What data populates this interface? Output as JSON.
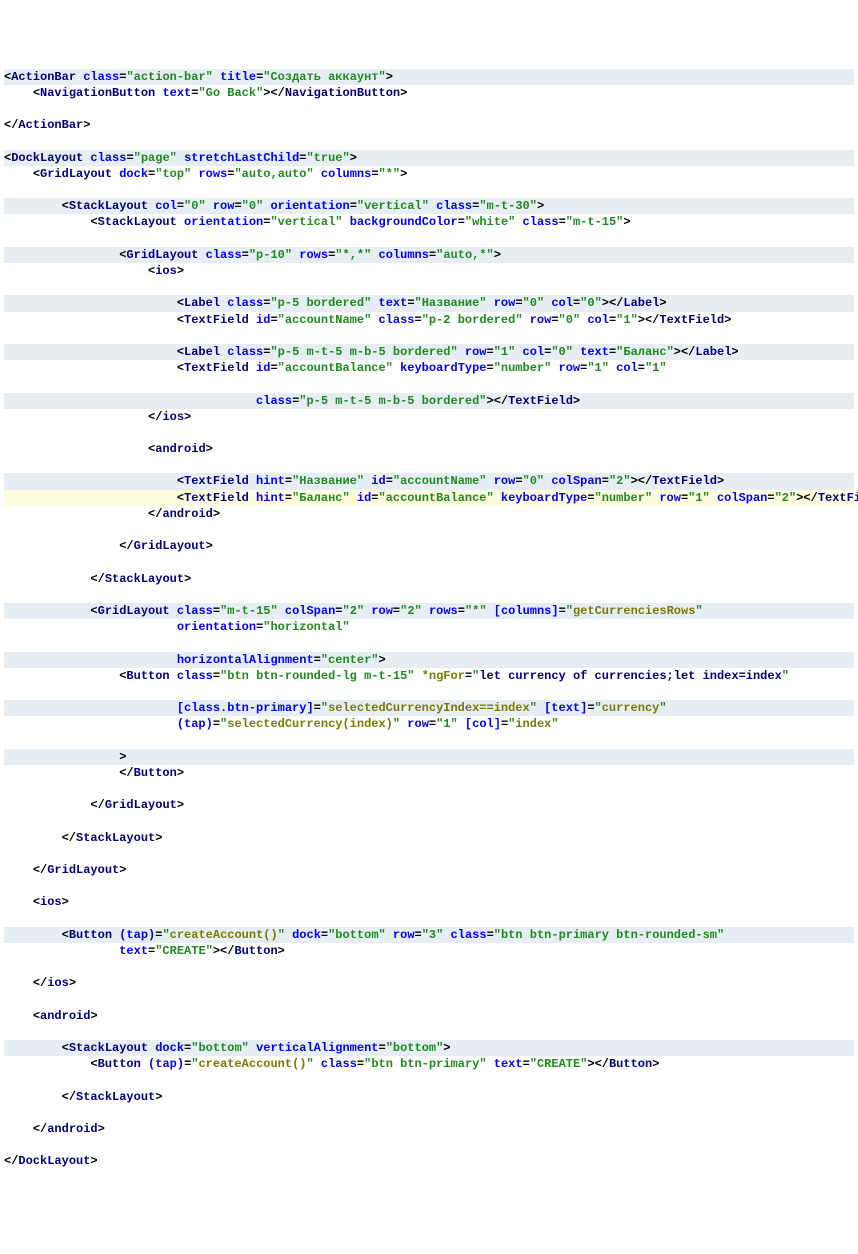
{
  "code": {
    "actionBar": {
      "tag": "ActionBar",
      "classAttr": "action-bar",
      "title": "Создать аккаунт"
    },
    "navButton": {
      "tag": "NavigationButton",
      "text": "Go Back"
    },
    "dockLayout": {
      "tag": "DockLayout",
      "classAttr": "page",
      "stretch": "true"
    },
    "grid1": {
      "tag": "GridLayout",
      "dock": "top",
      "rows": "auto,auto",
      "columns": "*"
    },
    "stack1": {
      "tag": "StackLayout",
      "col": "0",
      "row": "0",
      "orientation": "vertical",
      "classAttr": "m-t-30"
    },
    "stack2": {
      "tag": "StackLayout",
      "orientation": "vertical",
      "bg": "white",
      "classAttr": "m-t-15"
    },
    "grid2": {
      "tag": "GridLayout",
      "classAttr": "p-10",
      "rows": "*,*",
      "columns": "auto,*"
    },
    "iosTag": "ios",
    "label1": {
      "tag": "Label",
      "classAttr": "p-5 bordered",
      "text": "Название",
      "row": "0",
      "col": "0"
    },
    "tf1": {
      "tag": "TextField",
      "id": "accountName",
      "classAttr": "p-2 bordered",
      "row": "0",
      "col": "1"
    },
    "label2": {
      "tag": "Label",
      "classAttr": "p-5 m-t-5 m-b-5 bordered",
      "row": "1",
      "col": "0",
      "text": "Баланс"
    },
    "tf2": {
      "tag": "TextField",
      "id": "accountBalance",
      "keyboard": "number",
      "row": "1",
      "col": "1",
      "classAttr": "p-5 m-t-5 m-b-5 bordered"
    },
    "androidTag": "android",
    "tf3": {
      "tag": "TextField",
      "hint": "Название",
      "id": "accountName",
      "row": "0",
      "colSpan": "2"
    },
    "tf4": {
      "tag": "TextField",
      "hint": "Баланс",
      "id": "accountBalance",
      "keyboard": "number",
      "row": "1",
      "colSpan": "2"
    },
    "grid3": {
      "tag": "GridLayout",
      "classAttr": "m-t-15",
      "colSpan": "2",
      "row": "2",
      "rows": "*",
      "columnsBind": "getCurrenciesRows",
      "orientation": "horizontal",
      "hAlign": "center"
    },
    "button1": {
      "tag": "Button",
      "classAttr": "btn btn-rounded-lg m-t-15",
      "ngFor": "let currency of currencies;let index=index",
      "classBind": "selectedCurrencyIndex==index",
      "textBind": "currency",
      "tap": "selectedCurrency(index)",
      "row": "1",
      "colBind": "index"
    },
    "button2": {
      "tag": "Button",
      "tap": "createAccount()",
      "dock": "bottom",
      "row": "3",
      "classAttr": "btn btn-primary btn-rounded-sm",
      "text": "CREATE"
    },
    "stack3": {
      "tag": "StackLayout",
      "dock": "bottom",
      "vAlign": "bottom"
    },
    "button3": {
      "tag": "Button",
      "tap": "createAccount()",
      "classAttr": "btn btn-primary",
      "text": "CREATE"
    }
  }
}
